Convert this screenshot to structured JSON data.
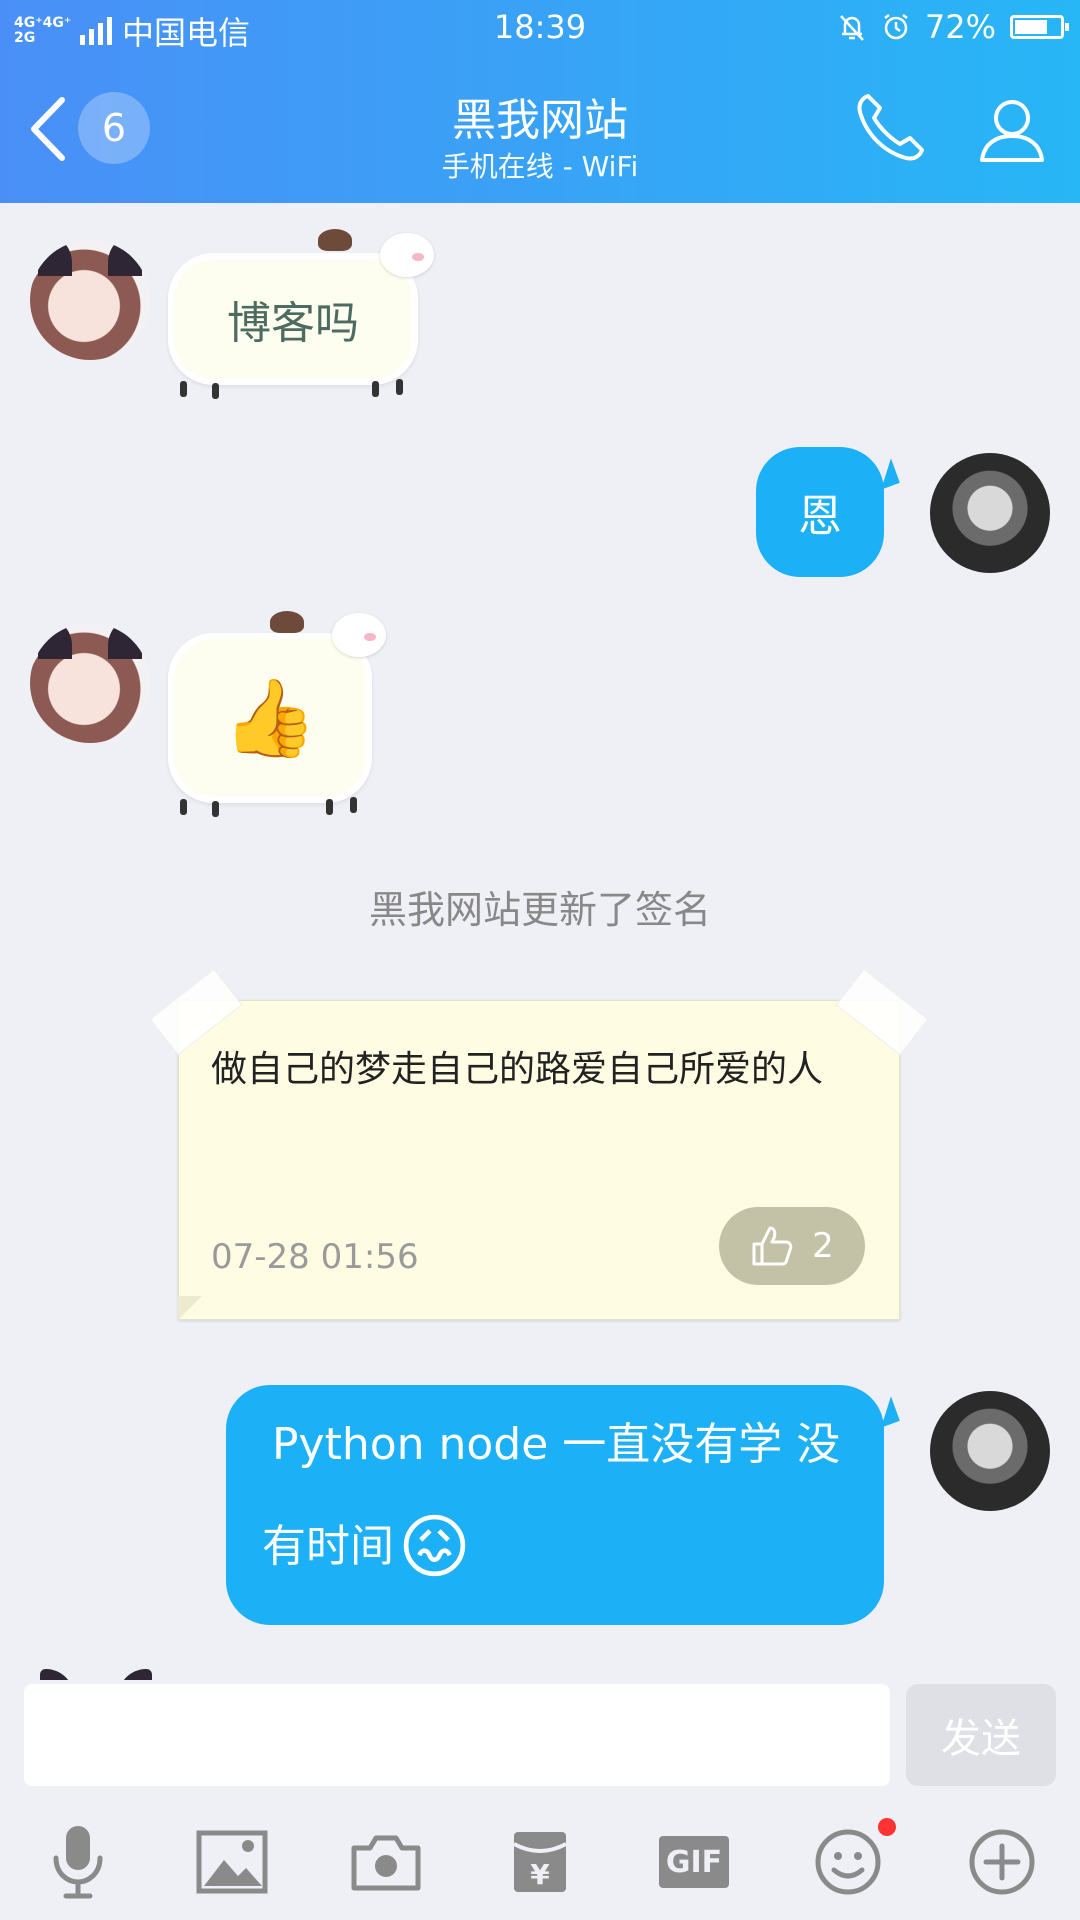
{
  "status_bar": {
    "network": "4G⁺4G⁺\n2G",
    "carrier": "中国电信",
    "time": "18:39",
    "battery": "72%",
    "battery_level": 0.72
  },
  "header": {
    "unread_count": "6",
    "title": "黑我网站",
    "subtitle": "手机在线 - WiFi"
  },
  "messages": [
    {
      "from": "other",
      "text": "博客吗",
      "style": "sheep"
    },
    {
      "from": "me",
      "text": "恩"
    },
    {
      "from": "other",
      "text": "",
      "emoji": "👍",
      "style": "sheep"
    }
  ],
  "system_note": "黑我网站更新了签名",
  "signature_card": {
    "text": "做自己的梦走自己的路爱自己所爱的人",
    "time": "07-28 01:56",
    "like_count": "2"
  },
  "last_message": {
    "from": "me",
    "text_line1": "Python node 一直没有学 没",
    "text_line2": "有时间",
    "emoji": "😖"
  },
  "input": {
    "placeholder": "",
    "send_label": "发送"
  },
  "toolbar": [
    {
      "icon": "microphone-icon"
    },
    {
      "icon": "image-icon"
    },
    {
      "icon": "camera-icon"
    },
    {
      "icon": "red-packet-icon"
    },
    {
      "icon": "gif-icon",
      "label": "GIF"
    },
    {
      "icon": "emoji-icon",
      "badge": true
    },
    {
      "icon": "plus-icon"
    }
  ],
  "colors": {
    "header_start": "#4a8ff7",
    "header_end": "#27b6f6",
    "my_bubble": "#1cb0f6",
    "background": "#eff0f6"
  }
}
